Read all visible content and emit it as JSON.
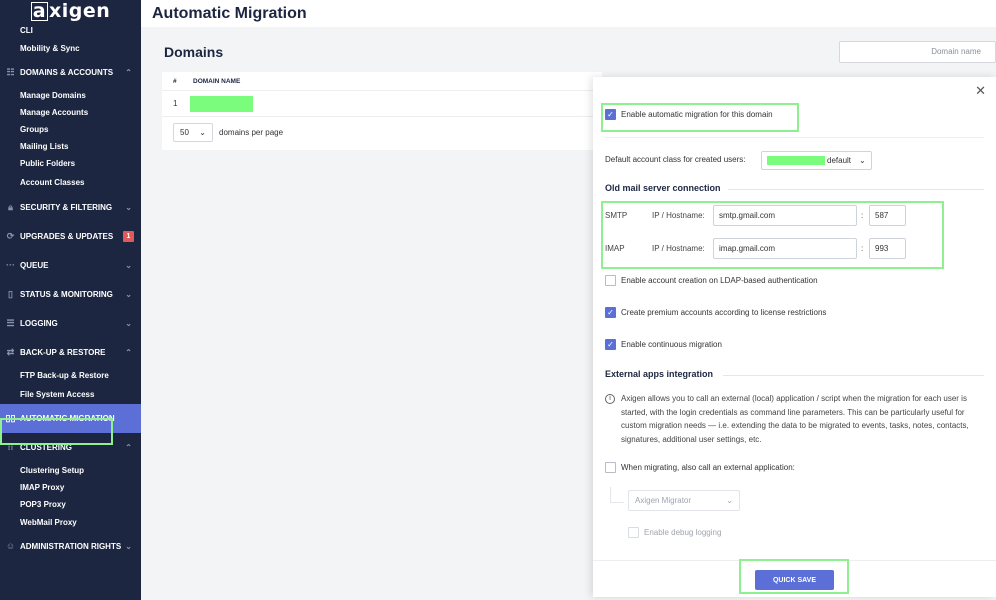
{
  "sidebar": {
    "logo": "axigen",
    "top_items": [
      "CLI",
      "Mobility & Sync"
    ],
    "sections": [
      {
        "label": "DOMAINS & ACCOUNTS",
        "icon": "domains-icon",
        "items": [
          "Manage Domains",
          "Manage Accounts",
          "Groups",
          "Mailing Lists",
          "Public Folders",
          "Account Classes"
        ]
      },
      {
        "label": "SECURITY & FILTERING",
        "icon": "lock-icon"
      },
      {
        "label": "UPGRADES & UPDATES",
        "icon": "refresh-icon",
        "badge": "1"
      },
      {
        "label": "QUEUE",
        "icon": "dots-icon"
      },
      {
        "label": "STATUS & MONITORING",
        "icon": "bar-chart-icon"
      },
      {
        "label": "LOGGING",
        "icon": "log-icon"
      },
      {
        "label": "BACK-UP & RESTORE",
        "icon": "transfer-icon",
        "items": [
          "FTP Back-up & Restore",
          "File System Access"
        ]
      },
      {
        "label": "AUTOMATIC MIGRATION",
        "icon": "migration-icon",
        "active": true
      },
      {
        "label": "CLUSTERING",
        "icon": "grid-icon",
        "items": [
          "Clustering Setup",
          "IMAP Proxy",
          "POP3 Proxy",
          "WebMail Proxy"
        ]
      },
      {
        "label": "ADMINISTRATION RIGHTS",
        "icon": "users-icon"
      }
    ]
  },
  "header": {
    "title": "Automatic Migration"
  },
  "domains": {
    "title": "Domains",
    "search_placeholder": "Domain name",
    "columns": [
      "#",
      "DOMAIN NAME"
    ],
    "rows": [
      {
        "index": "1"
      }
    ],
    "per_page_value": "50",
    "per_page_label": "domains per page"
  },
  "panel": {
    "enable_migration": "Enable automatic migration for this domain",
    "default_class_label": "Default account class for created users:",
    "default_class_value": "default",
    "old_server_title": "Old mail server connection",
    "smtp_label": "SMTP",
    "imap_label": "IMAP",
    "host_label": "IP / Hostname:",
    "smtp_host": "smtp.gmail.com",
    "smtp_port": "587",
    "imap_host": "imap.gmail.com",
    "imap_port": "993",
    "colon": ":",
    "ldap_creation": "Enable account creation on LDAP-based authentication",
    "premium_accounts": "Create premium accounts according to license restrictions",
    "continuous_migration": "Enable continuous migration",
    "external_title": "External apps integration",
    "external_info": "Axigen allows you to call an external (local) application / script when the migration for each user is started, with the login credentials as command line parameters. This can be particularly useful for custom migration needs — i.e. extending the data to be migrated to events, tasks, notes, contacts, signatures, additional user settings, etc.",
    "call_external": "When migrating, also call an external application:",
    "external_app_value": "Axigen Migrator",
    "debug_logging": "Enable debug logging",
    "save_label": "QUICK SAVE"
  },
  "colors": {
    "sidebar_bg": "#1c2640",
    "accent": "#5b6fd6",
    "highlight": "#8ef08e",
    "badge": "#e05a5a"
  }
}
